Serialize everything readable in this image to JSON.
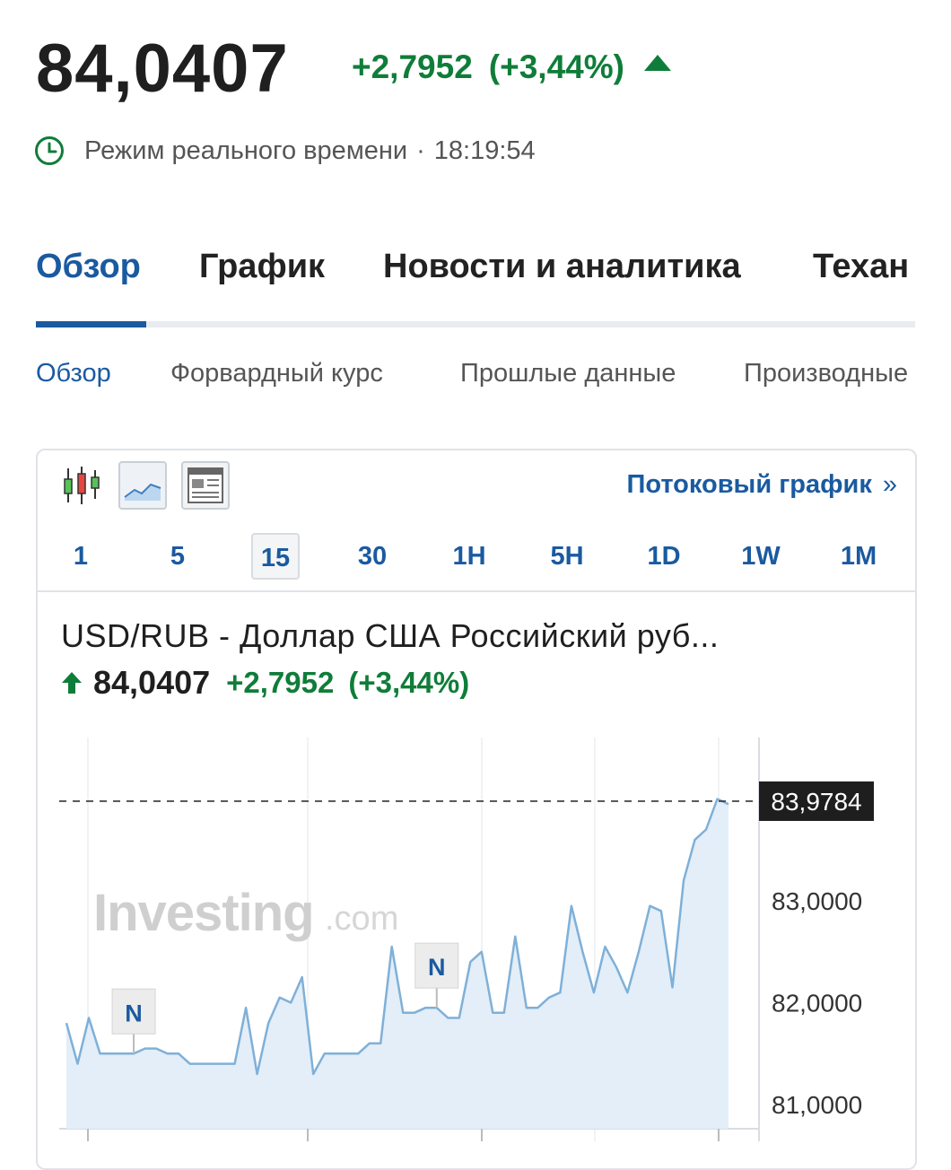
{
  "header": {
    "price": "84,0407",
    "change": "+2,7952",
    "change_pct": "(+3,44%)",
    "realtime_label": "Режим реального времени",
    "separator": "·",
    "time": "18:19:54"
  },
  "main_tabs": [
    "Обзор",
    "График",
    "Новости и аналитика",
    "Техан"
  ],
  "sub_tabs": [
    "Обзор",
    "Форвардный курс",
    "Прошлые данные",
    "Производные"
  ],
  "toolbar": {
    "stream_label": "Потоковый график",
    "stream_chevron": "»",
    "intervals": [
      "1",
      "5",
      "15",
      "30",
      "1H",
      "5H",
      "1D",
      "1W",
      "1M"
    ],
    "active_interval": "15"
  },
  "chart_header": {
    "title": "USD/RUB - Доллар США Российский руб...",
    "price": "84,0407",
    "change": "+2,7952",
    "change_pct": "(+3,44%)"
  },
  "colors": {
    "up_green": "#0f7d39",
    "accent_blue": "#1a5aa0",
    "line_blue": "#7fb0d8",
    "area_fill": "#e3eef8"
  },
  "chart_data": {
    "type": "area",
    "watermark": "Investing.com",
    "y_ticks": [
      "83,0000",
      "82,0000",
      "81,0000"
    ],
    "y_tick_values": [
      83.0,
      82.0,
      81.0
    ],
    "current_label": "83,9784",
    "current_value": 83.9784,
    "news_markers": [
      {
        "label": "N",
        "index": 6
      },
      {
        "label": "N",
        "index": 33
      }
    ],
    "values": [
      81.8,
      81.4,
      81.85,
      81.5,
      81.5,
      81.5,
      81.5,
      81.55,
      81.55,
      81.5,
      81.5,
      81.4,
      81.4,
      81.4,
      81.4,
      81.4,
      81.95,
      81.3,
      81.8,
      82.05,
      82.0,
      82.25,
      81.3,
      81.5,
      81.5,
      81.5,
      81.5,
      81.6,
      81.6,
      82.55,
      81.9,
      81.9,
      81.95,
      81.95,
      81.85,
      81.85,
      82.4,
      82.5,
      81.9,
      81.9,
      82.65,
      81.95,
      81.95,
      82.05,
      82.1,
      82.95,
      82.5,
      82.1,
      82.55,
      82.35,
      82.1,
      82.5,
      82.95,
      82.9,
      82.15,
      83.2,
      83.6,
      83.7,
      84.0,
      83.95
    ]
  }
}
